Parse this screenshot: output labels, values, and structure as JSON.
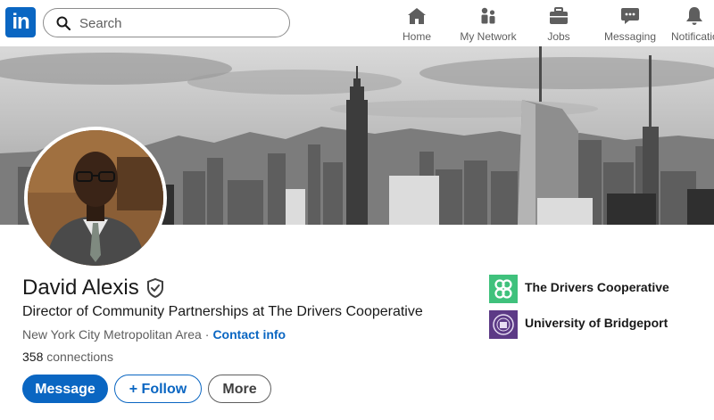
{
  "nav": {
    "logo_text": "in",
    "search": {
      "placeholder": "Search"
    },
    "items": [
      {
        "label": "Home",
        "icon": "home-icon"
      },
      {
        "label": "My Network",
        "icon": "my-network-icon"
      },
      {
        "label": "Jobs",
        "icon": "jobs-icon"
      },
      {
        "label": "Messaging",
        "icon": "messaging-icon"
      },
      {
        "label": "Notifications",
        "icon": "bell-icon"
      }
    ]
  },
  "profile": {
    "name": "David Alexis",
    "headline": "Director of Community Partnerships at The Drivers Cooperative",
    "location": "New York City Metropolitan Area",
    "location_separator": "·",
    "contact_info_label": "Contact info",
    "connections_count": "358",
    "connections_label": "connections",
    "actions": {
      "message": "Message",
      "follow": "+ Follow",
      "more": "More"
    },
    "organizations": [
      {
        "name": "The Drivers Cooperative",
        "logo_color": "#3fc17c"
      },
      {
        "name": "University of Bridgeport",
        "logo_color": "#5c3a86"
      }
    ]
  },
  "colors": {
    "brand": "#0a66c2",
    "text_primary": "#191919",
    "text_secondary": "#5e5e5e",
    "page_background": "#f3f2ef"
  }
}
